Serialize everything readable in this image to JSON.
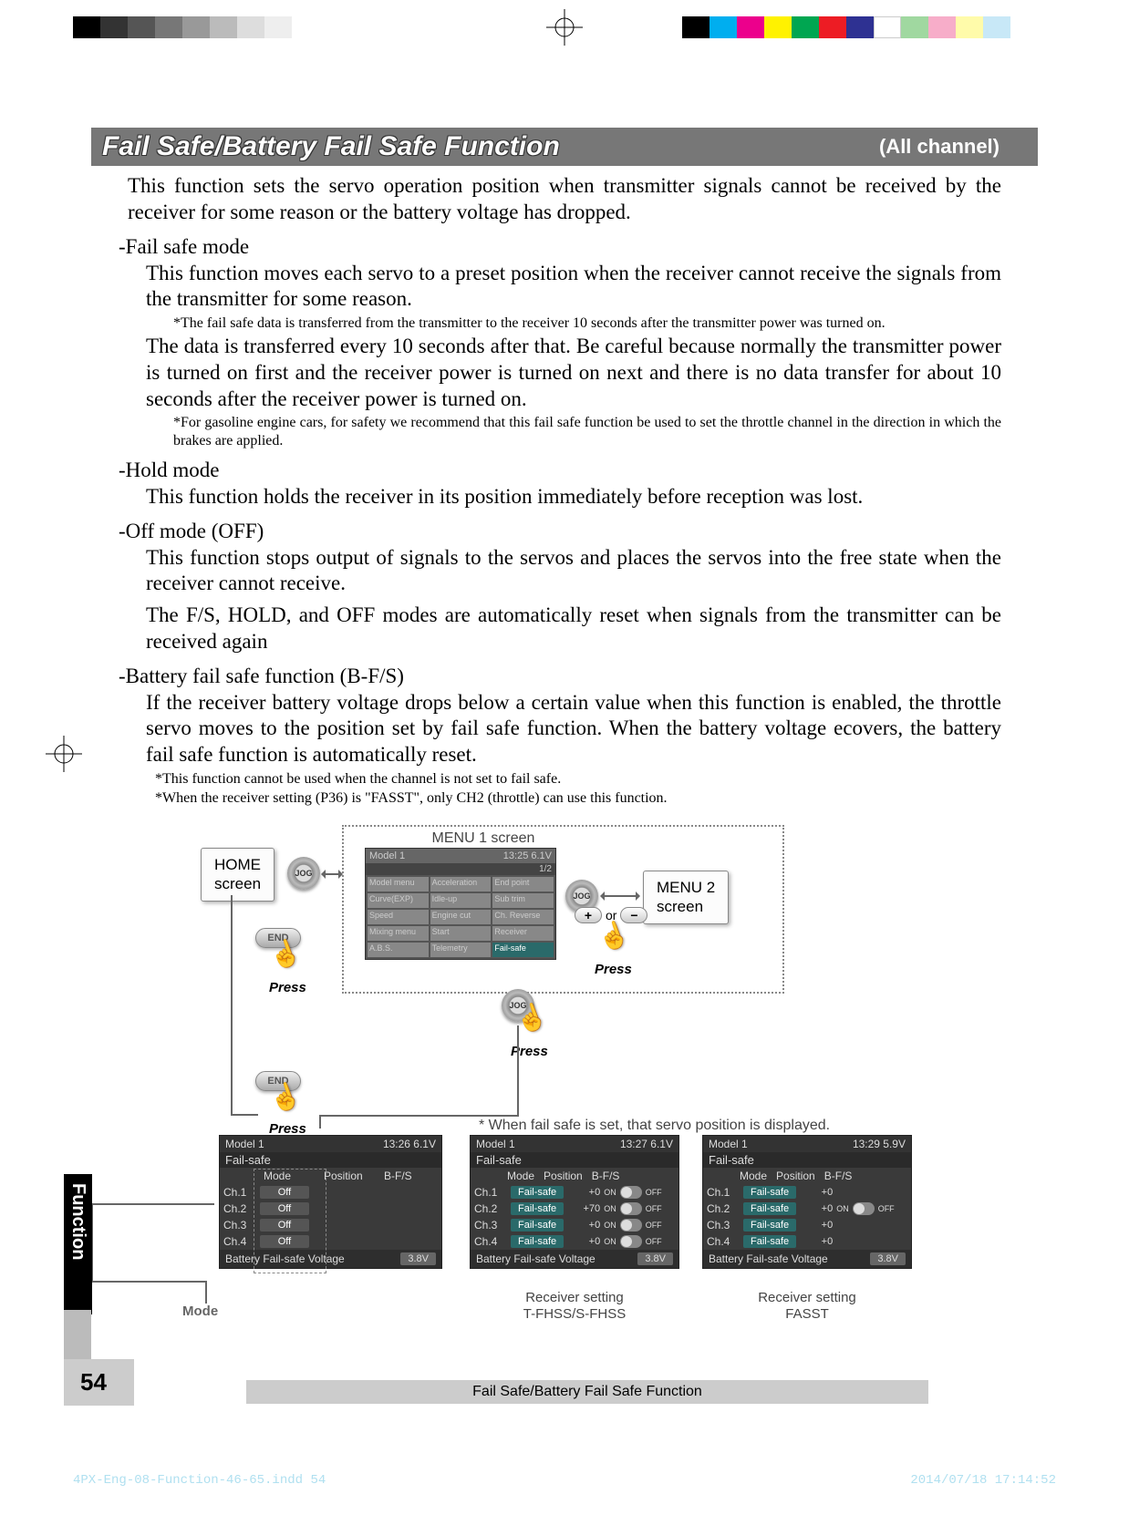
{
  "page_number": "54",
  "side_tab": "Function",
  "footer": "Fail Safe/Battery Fail Safe Function",
  "print_footer_left": "4PX-Eng-08-Function-46-65.indd   54",
  "print_footer_right": "2014/07/18   17:14:52",
  "header": {
    "title": "Fail Safe/Battery Fail Safe Function",
    "subtitle": "(All channel)"
  },
  "intro": "This function sets the servo operation position when transmitter signals cannot be received by the receiver for some reason or the battery voltage has dropped.",
  "failsafe": {
    "heading": "-Fail safe mode",
    "p1": "This function moves each servo to a preset position when the receiver cannot receive the signals from the transmitter for some reason.",
    "note1": "*The fail safe data is transferred from the transmitter to the receiver 10 seconds after the transmitter power was turned on.",
    "p2": "The data is transferred every 10 seconds after that. Be careful because normally the transmitter power is turned on first and the receiver power is turned on next and there is no data transfer for about 10 seconds after the receiver power is turned on.",
    "note2": "*For gasoline engine cars, for safety we recommend that this fail safe function be used to set the throttle channel in the direction in which the brakes are applied."
  },
  "hold": {
    "heading": "-Hold mode",
    "p1": "This function holds the receiver in its position immediately before reception was lost."
  },
  "off": {
    "heading": "-Off mode (OFF)",
    "p1": "This function stops output of signals to the servos and places the servos into the free state when the receiver cannot receive.",
    "p2": "The F/S, HOLD, and OFF modes are automatically reset when signals from the transmitter can be received again"
  },
  "bfs": {
    "heading": "-Battery fail safe function (B-F/S)",
    "p1": "If the receiver battery voltage drops below a certain value when this function is enabled, the throttle servo moves to the position set by fail safe function. When the battery voltage ecovers, the battery fail safe function is automatically reset.",
    "note1": "*This function cannot be used when the channel is not set to fail safe.",
    "note2": "*When the receiver setting (P36) is \"FASST\", only CH2 (throttle) can use this function."
  },
  "diagram": {
    "menu1_label": "MENU 1 screen",
    "home_label": "HOME\nscreen",
    "menu2_label": "MENU 2\nscreen",
    "press": "Press",
    "or": "or",
    "mode_label": "Mode",
    "set_note": "* When fail safe is set, that servo position is displayed.",
    "recv_tfhss": "Receiver setting\nT-FHSS/S-FHSS",
    "recv_fasst": "Receiver setting\nFASST",
    "jog": "JOG",
    "end": "END",
    "menu_shot": {
      "model": "Model 1",
      "clock": "13:25 6.1V",
      "page": "1/2",
      "cells": [
        "Model menu",
        "Acceleration",
        "End point",
        "Curve(EXP)",
        "Idle-up",
        "Sub trim",
        "Speed",
        "Engine cut",
        "Ch. Reverse",
        "Mixing menu",
        "Start",
        "Receiver",
        "A.B.S.",
        "Telemetry",
        "Fail-safe"
      ]
    },
    "fs_main": {
      "model": "Model 1",
      "clock": "13:26 6.1V",
      "title": "Fail-safe",
      "cols": [
        "Mode",
        "Position",
        "B-F/S"
      ],
      "rows": [
        {
          "ch": "Ch.1",
          "mode": "Off"
        },
        {
          "ch": "Ch.2",
          "mode": "Off"
        },
        {
          "ch": "Ch.3",
          "mode": "Off"
        },
        {
          "ch": "Ch.4",
          "mode": "Off"
        }
      ],
      "bfs_label": "Battery Fail-safe Voltage",
      "bfs_val": "3.8V"
    },
    "fs_tfhss": {
      "model": "Model 1",
      "clock": "13:27 6.1V",
      "title": "Fail-safe",
      "cols": [
        "Mode",
        "Position",
        "B-F/S"
      ],
      "rows": [
        {
          "ch": "Ch.1",
          "mode": "Fail-safe",
          "pos": "+0",
          "on": "ON",
          "off": "OFF"
        },
        {
          "ch": "Ch.2",
          "mode": "Fail-safe",
          "pos": "+70",
          "on": "ON",
          "off": "OFF"
        },
        {
          "ch": "Ch.3",
          "mode": "Fail-safe",
          "pos": "+0",
          "on": "ON",
          "off": "OFF"
        },
        {
          "ch": "Ch.4",
          "mode": "Fail-safe",
          "pos": "+0",
          "on": "ON",
          "off": "OFF"
        }
      ],
      "bfs_label": "Battery Fail-safe Voltage",
      "bfs_val": "3.8V"
    },
    "fs_fasst": {
      "model": "Model 1",
      "clock": "13:29 5.9V",
      "title": "Fail-safe",
      "cols": [
        "Mode",
        "Position",
        "B-F/S"
      ],
      "rows": [
        {
          "ch": "Ch.1",
          "mode": "Fail-safe",
          "pos": "+0"
        },
        {
          "ch": "Ch.2",
          "mode": "Fail-safe",
          "pos": "+0",
          "on": "ON",
          "off": "OFF"
        },
        {
          "ch": "Ch.3",
          "mode": "Fail-safe",
          "pos": "+0"
        },
        {
          "ch": "Ch.4",
          "mode": "Fail-safe",
          "pos": "+0"
        }
      ],
      "bfs_label": "Battery Fail-safe Voltage",
      "bfs_val": "3.8V"
    }
  }
}
